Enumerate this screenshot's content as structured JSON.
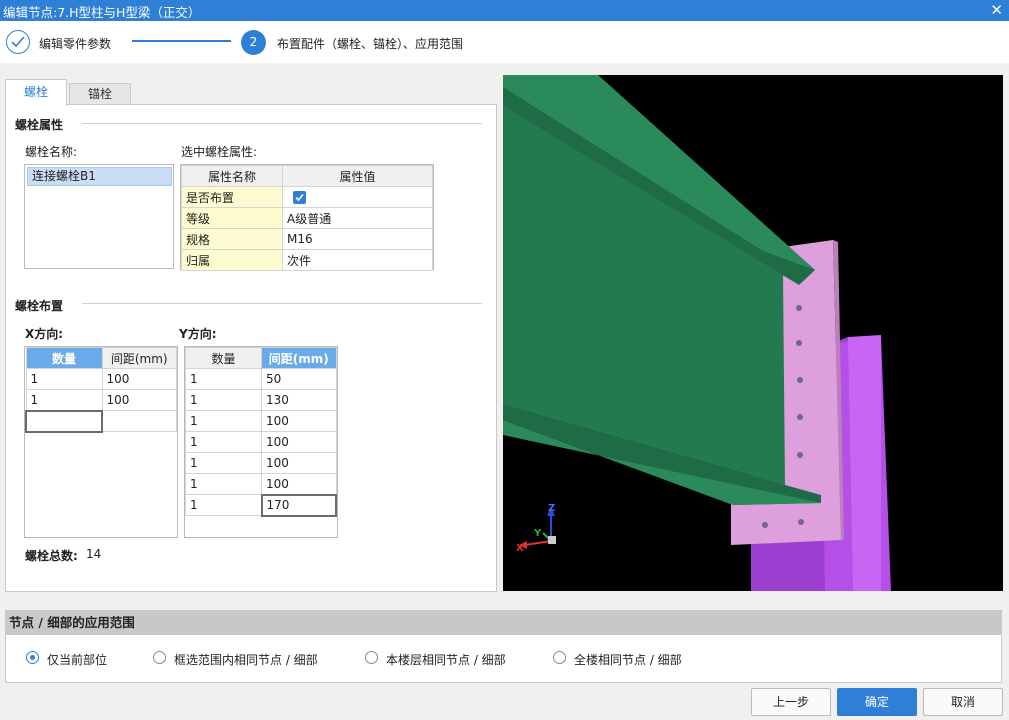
{
  "window": {
    "title": "编辑节点:7.H型柱与H型梁（正交）",
    "close_glyph": "✕"
  },
  "wizard": {
    "step1_label": "编辑零件参数",
    "step2_number": "2",
    "step2_label": "布置配件（螺栓、锚栓）、应用范围"
  },
  "tabs": [
    {
      "label": "螺栓",
      "active": true
    },
    {
      "label": "锚栓",
      "active": false
    }
  ],
  "bolt_properties": {
    "section_title": "螺栓属性",
    "name_label": "螺栓名称:",
    "names": [
      "连接螺栓B1"
    ],
    "selected_label": "选中螺栓属性:",
    "columns": [
      "属性名称",
      "属性值"
    ],
    "rows": [
      {
        "name": "是否布置",
        "value": "",
        "checked": true
      },
      {
        "name": "等级",
        "value": "A级普通"
      },
      {
        "name": "规格",
        "value": "M16"
      },
      {
        "name": "归属",
        "value": "次件"
      }
    ]
  },
  "bolt_layout": {
    "section_title": "螺栓布置",
    "x_label": "X方向:",
    "y_label": "Y方向:",
    "x_columns": [
      "数量",
      "间距(mm)"
    ],
    "x_rows": [
      [
        "1",
        "100"
      ],
      [
        "1",
        "100"
      ]
    ],
    "y_columns": [
      "数量",
      "间距(mm)"
    ],
    "y_rows": [
      [
        "1",
        "50"
      ],
      [
        "1",
        "130"
      ],
      [
        "1",
        "100"
      ],
      [
        "1",
        "100"
      ],
      [
        "1",
        "100"
      ],
      [
        "1",
        "100"
      ],
      [
        "1",
        "170"
      ]
    ],
    "total_label": "螺栓总数:",
    "total_value": "14"
  },
  "axes": {
    "x": "X",
    "y": "Y",
    "z": "Z"
  },
  "scope": {
    "title": "节点 / 细部的应用范围",
    "options": [
      {
        "label": "仅当前部位",
        "selected": true
      },
      {
        "label": "框选范围内相同节点 / 细部",
        "selected": false
      },
      {
        "label": "本楼层相同节点 / 细部",
        "selected": false
      },
      {
        "label": "全楼相同节点 / 细部",
        "selected": false
      }
    ]
  },
  "buttons": {
    "prev": "上一步",
    "ok": "确定",
    "cancel": "取消"
  },
  "colors": {
    "accent": "#2f7fd6",
    "beam": "#237a4f",
    "plate": "#dda0dd",
    "column": "#b44fe8"
  }
}
